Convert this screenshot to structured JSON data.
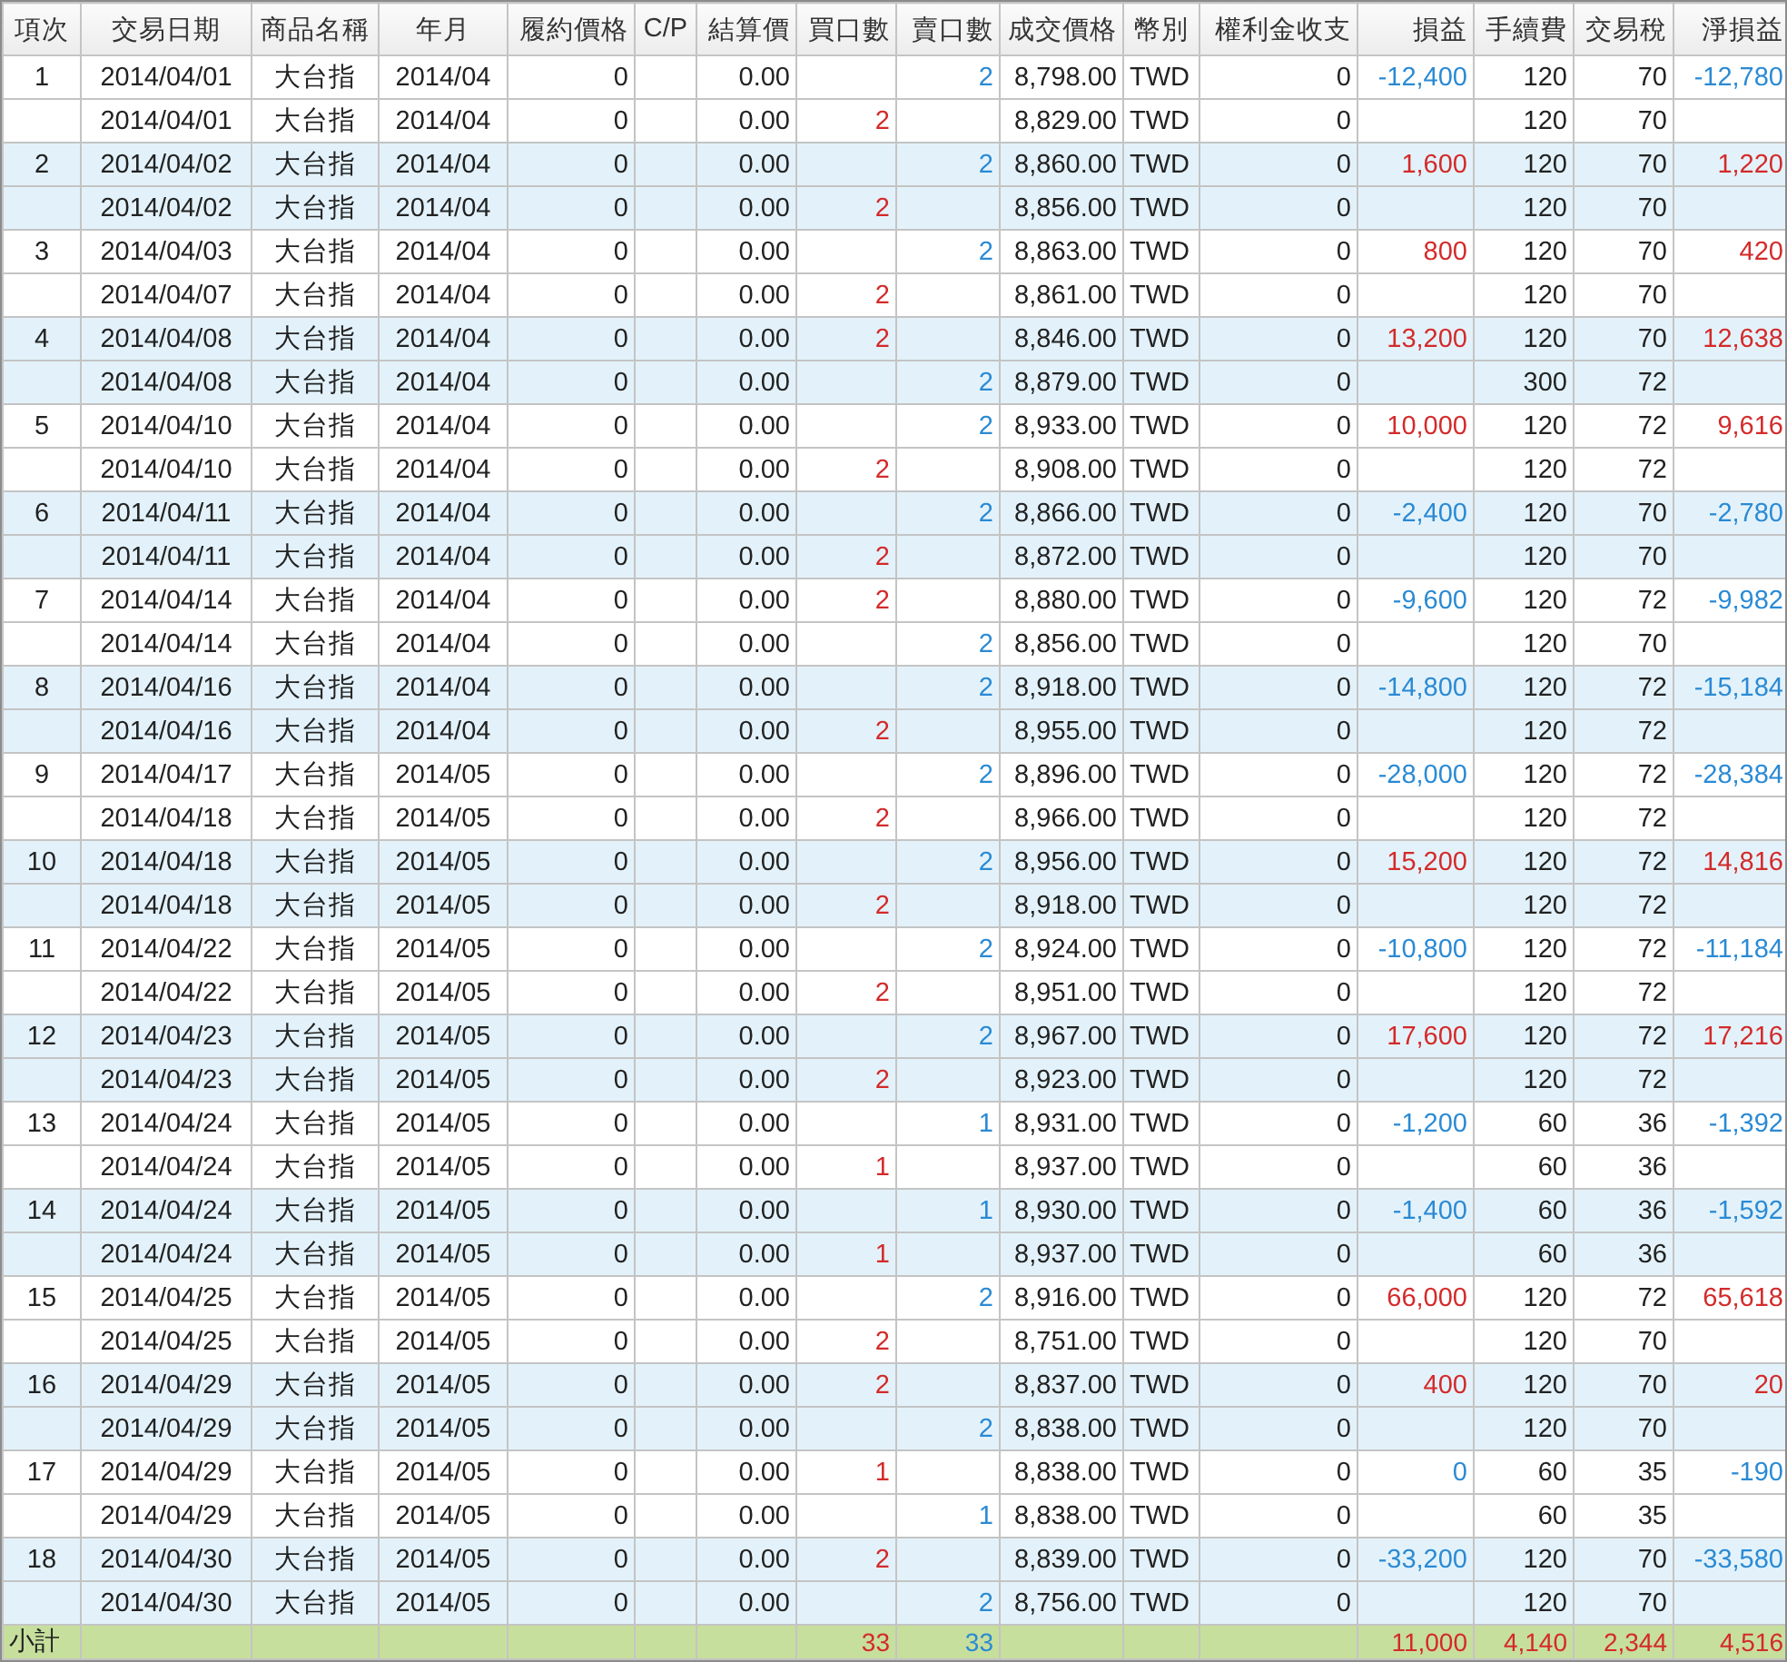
{
  "columns": [
    "項次",
    "交易日期",
    "商品名稱",
    "年月",
    "履約價格",
    "C/P",
    "結算價",
    "買口數",
    "賣口數",
    "成交價格",
    "幣別",
    "權利金收支",
    "損益",
    "手續費",
    "交易稅",
    "淨損益"
  ],
  "items": [
    {
      "no": "1",
      "pnl": {
        "value": "-12,400",
        "color": "#2a8ad4"
      },
      "net": {
        "value": "-12,780",
        "color": "#2a8ad4"
      },
      "trades": [
        {
          "date": "2014/04/01",
          "product": "大台指",
          "month": "2014/04",
          "strike": "0",
          "settle": "0.00",
          "sell": "2",
          "price": "8,798.00",
          "currency": "TWD",
          "premium": "0",
          "fee": "120",
          "tax": "70"
        },
        {
          "date": "2014/04/01",
          "product": "大台指",
          "month": "2014/04",
          "strike": "0",
          "settle": "0.00",
          "buy": "2",
          "price": "8,829.00",
          "currency": "TWD",
          "premium": "0",
          "fee": "120",
          "tax": "70"
        }
      ]
    },
    {
      "no": "2",
      "pnl": {
        "value": "1,600",
        "color": "#d42a2a"
      },
      "net": {
        "value": "1,220",
        "color": "#d42a2a"
      },
      "trades": [
        {
          "date": "2014/04/02",
          "product": "大台指",
          "month": "2014/04",
          "strike": "0",
          "settle": "0.00",
          "sell": "2",
          "price": "8,860.00",
          "currency": "TWD",
          "premium": "0",
          "fee": "120",
          "tax": "70"
        },
        {
          "date": "2014/04/02",
          "product": "大台指",
          "month": "2014/04",
          "strike": "0",
          "settle": "0.00",
          "buy": "2",
          "price": "8,856.00",
          "currency": "TWD",
          "premium": "0",
          "fee": "120",
          "tax": "70"
        }
      ]
    },
    {
      "no": "3",
      "pnl": {
        "value": "800",
        "color": "#d42a2a"
      },
      "net": {
        "value": "420",
        "color": "#d42a2a"
      },
      "trades": [
        {
          "date": "2014/04/03",
          "product": "大台指",
          "month": "2014/04",
          "strike": "0",
          "settle": "0.00",
          "sell": "2",
          "price": "8,863.00",
          "currency": "TWD",
          "premium": "0",
          "fee": "120",
          "tax": "70"
        },
        {
          "date": "2014/04/07",
          "product": "大台指",
          "month": "2014/04",
          "strike": "0",
          "settle": "0.00",
          "buy": "2",
          "price": "8,861.00",
          "currency": "TWD",
          "premium": "0",
          "fee": "120",
          "tax": "70"
        }
      ]
    },
    {
      "no": "4",
      "pnl": {
        "value": "13,200",
        "color": "#d42a2a"
      },
      "net": {
        "value": "12,638",
        "color": "#d42a2a"
      },
      "trades": [
        {
          "date": "2014/04/08",
          "product": "大台指",
          "month": "2014/04",
          "strike": "0",
          "settle": "0.00",
          "buy": "2",
          "price": "8,846.00",
          "currency": "TWD",
          "premium": "0",
          "fee": "120",
          "tax": "70"
        },
        {
          "date": "2014/04/08",
          "product": "大台指",
          "month": "2014/04",
          "strike": "0",
          "settle": "0.00",
          "sell": "2",
          "price": "8,879.00",
          "currency": "TWD",
          "premium": "0",
          "fee": "300",
          "tax": "72"
        }
      ]
    },
    {
      "no": "5",
      "pnl": {
        "value": "10,000",
        "color": "#d42a2a"
      },
      "net": {
        "value": "9,616",
        "color": "#d42a2a"
      },
      "trades": [
        {
          "date": "2014/04/10",
          "product": "大台指",
          "month": "2014/04",
          "strike": "0",
          "settle": "0.00",
          "sell": "2",
          "price": "8,933.00",
          "currency": "TWD",
          "premium": "0",
          "fee": "120",
          "tax": "72"
        },
        {
          "date": "2014/04/10",
          "product": "大台指",
          "month": "2014/04",
          "strike": "0",
          "settle": "0.00",
          "buy": "2",
          "price": "8,908.00",
          "currency": "TWD",
          "premium": "0",
          "fee": "120",
          "tax": "72"
        }
      ]
    },
    {
      "no": "6",
      "pnl": {
        "value": "-2,400",
        "color": "#2a8ad4"
      },
      "net": {
        "value": "-2,780",
        "color": "#2a8ad4"
      },
      "trades": [
        {
          "date": "2014/04/11",
          "product": "大台指",
          "month": "2014/04",
          "strike": "0",
          "settle": "0.00",
          "sell": "2",
          "price": "8,866.00",
          "currency": "TWD",
          "premium": "0",
          "fee": "120",
          "tax": "70"
        },
        {
          "date": "2014/04/11",
          "product": "大台指",
          "month": "2014/04",
          "strike": "0",
          "settle": "0.00",
          "buy": "2",
          "price": "8,872.00",
          "currency": "TWD",
          "premium": "0",
          "fee": "120",
          "tax": "70"
        }
      ]
    },
    {
      "no": "7",
      "pnl": {
        "value": "-9,600",
        "color": "#2a8ad4"
      },
      "net": {
        "value": "-9,982",
        "color": "#2a8ad4"
      },
      "trades": [
        {
          "date": "2014/04/14",
          "product": "大台指",
          "month": "2014/04",
          "strike": "0",
          "settle": "0.00",
          "buy": "2",
          "price": "8,880.00",
          "currency": "TWD",
          "premium": "0",
          "fee": "120",
          "tax": "72"
        },
        {
          "date": "2014/04/14",
          "product": "大台指",
          "month": "2014/04",
          "strike": "0",
          "settle": "0.00",
          "sell": "2",
          "price": "8,856.00",
          "currency": "TWD",
          "premium": "0",
          "fee": "120",
          "tax": "70"
        }
      ]
    },
    {
      "no": "8",
      "pnl": {
        "value": "-14,800",
        "color": "#2a8ad4"
      },
      "net": {
        "value": "-15,184",
        "color": "#2a8ad4"
      },
      "trades": [
        {
          "date": "2014/04/16",
          "product": "大台指",
          "month": "2014/04",
          "strike": "0",
          "settle": "0.00",
          "sell": "2",
          "price": "8,918.00",
          "currency": "TWD",
          "premium": "0",
          "fee": "120",
          "tax": "72"
        },
        {
          "date": "2014/04/16",
          "product": "大台指",
          "month": "2014/04",
          "strike": "0",
          "settle": "0.00",
          "buy": "2",
          "price": "8,955.00",
          "currency": "TWD",
          "premium": "0",
          "fee": "120",
          "tax": "72"
        }
      ]
    },
    {
      "no": "9",
      "pnl": {
        "value": "-28,000",
        "color": "#2a8ad4"
      },
      "net": {
        "value": "-28,384",
        "color": "#2a8ad4"
      },
      "trades": [
        {
          "date": "2014/04/17",
          "product": "大台指",
          "month": "2014/05",
          "strike": "0",
          "settle": "0.00",
          "sell": "2",
          "price": "8,896.00",
          "currency": "TWD",
          "premium": "0",
          "fee": "120",
          "tax": "72"
        },
        {
          "date": "2014/04/18",
          "product": "大台指",
          "month": "2014/05",
          "strike": "0",
          "settle": "0.00",
          "buy": "2",
          "price": "8,966.00",
          "currency": "TWD",
          "premium": "0",
          "fee": "120",
          "tax": "72"
        }
      ]
    },
    {
      "no": "10",
      "pnl": {
        "value": "15,200",
        "color": "#d42a2a"
      },
      "net": {
        "value": "14,816",
        "color": "#d42a2a"
      },
      "trades": [
        {
          "date": "2014/04/18",
          "product": "大台指",
          "month": "2014/05",
          "strike": "0",
          "settle": "0.00",
          "sell": "2",
          "price": "8,956.00",
          "currency": "TWD",
          "premium": "0",
          "fee": "120",
          "tax": "72"
        },
        {
          "date": "2014/04/18",
          "product": "大台指",
          "month": "2014/05",
          "strike": "0",
          "settle": "0.00",
          "buy": "2",
          "price": "8,918.00",
          "currency": "TWD",
          "premium": "0",
          "fee": "120",
          "tax": "72"
        }
      ]
    },
    {
      "no": "11",
      "pnl": {
        "value": "-10,800",
        "color": "#2a8ad4"
      },
      "net": {
        "value": "-11,184",
        "color": "#2a8ad4"
      },
      "trades": [
        {
          "date": "2014/04/22",
          "product": "大台指",
          "month": "2014/05",
          "strike": "0",
          "settle": "0.00",
          "sell": "2",
          "price": "8,924.00",
          "currency": "TWD",
          "premium": "0",
          "fee": "120",
          "tax": "72"
        },
        {
          "date": "2014/04/22",
          "product": "大台指",
          "month": "2014/05",
          "strike": "0",
          "settle": "0.00",
          "buy": "2",
          "price": "8,951.00",
          "currency": "TWD",
          "premium": "0",
          "fee": "120",
          "tax": "72"
        }
      ]
    },
    {
      "no": "12",
      "pnl": {
        "value": "17,600",
        "color": "#d42a2a"
      },
      "net": {
        "value": "17,216",
        "color": "#d42a2a"
      },
      "trades": [
        {
          "date": "2014/04/23",
          "product": "大台指",
          "month": "2014/05",
          "strike": "0",
          "settle": "0.00",
          "sell": "2",
          "price": "8,967.00",
          "currency": "TWD",
          "premium": "0",
          "fee": "120",
          "tax": "72"
        },
        {
          "date": "2014/04/23",
          "product": "大台指",
          "month": "2014/05",
          "strike": "0",
          "settle": "0.00",
          "buy": "2",
          "price": "8,923.00",
          "currency": "TWD",
          "premium": "0",
          "fee": "120",
          "tax": "72"
        }
      ]
    },
    {
      "no": "13",
      "pnl": {
        "value": "-1,200",
        "color": "#2a8ad4"
      },
      "net": {
        "value": "-1,392",
        "color": "#2a8ad4"
      },
      "trades": [
        {
          "date": "2014/04/24",
          "product": "大台指",
          "month": "2014/05",
          "strike": "0",
          "settle": "0.00",
          "sell": "1",
          "price": "8,931.00",
          "currency": "TWD",
          "premium": "0",
          "fee": "60",
          "tax": "36"
        },
        {
          "date": "2014/04/24",
          "product": "大台指",
          "month": "2014/05",
          "strike": "0",
          "settle": "0.00",
          "buy": "1",
          "price": "8,937.00",
          "currency": "TWD",
          "premium": "0",
          "fee": "60",
          "tax": "36"
        }
      ]
    },
    {
      "no": "14",
      "pnl": {
        "value": "-1,400",
        "color": "#2a8ad4"
      },
      "net": {
        "value": "-1,592",
        "color": "#2a8ad4"
      },
      "trades": [
        {
          "date": "2014/04/24",
          "product": "大台指",
          "month": "2014/05",
          "strike": "0",
          "settle": "0.00",
          "sell": "1",
          "price": "8,930.00",
          "currency": "TWD",
          "premium": "0",
          "fee": "60",
          "tax": "36"
        },
        {
          "date": "2014/04/24",
          "product": "大台指",
          "month": "2014/05",
          "strike": "0",
          "settle": "0.00",
          "buy": "1",
          "price": "8,937.00",
          "currency": "TWD",
          "premium": "0",
          "fee": "60",
          "tax": "36"
        }
      ]
    },
    {
      "no": "15",
      "pnl": {
        "value": "66,000",
        "color": "#d42a2a"
      },
      "net": {
        "value": "65,618",
        "color": "#d42a2a"
      },
      "trades": [
        {
          "date": "2014/04/25",
          "product": "大台指",
          "month": "2014/05",
          "strike": "0",
          "settle": "0.00",
          "sell": "2",
          "price": "8,916.00",
          "currency": "TWD",
          "premium": "0",
          "fee": "120",
          "tax": "72"
        },
        {
          "date": "2014/04/25",
          "product": "大台指",
          "month": "2014/05",
          "strike": "0",
          "settle": "0.00",
          "buy": "2",
          "price": "8,751.00",
          "currency": "TWD",
          "premium": "0",
          "fee": "120",
          "tax": "70"
        }
      ]
    },
    {
      "no": "16",
      "pnl": {
        "value": "400",
        "color": "#d42a2a"
      },
      "net": {
        "value": "20",
        "color": "#d42a2a"
      },
      "trades": [
        {
          "date": "2014/04/29",
          "product": "大台指",
          "month": "2014/05",
          "strike": "0",
          "settle": "0.00",
          "buy": "2",
          "price": "8,837.00",
          "currency": "TWD",
          "premium": "0",
          "fee": "120",
          "tax": "70"
        },
        {
          "date": "2014/04/29",
          "product": "大台指",
          "month": "2014/05",
          "strike": "0",
          "settle": "0.00",
          "sell": "2",
          "price": "8,838.00",
          "currency": "TWD",
          "premium": "0",
          "fee": "120",
          "tax": "70"
        }
      ]
    },
    {
      "no": "17",
      "pnl": {
        "value": "0",
        "color": "#2a8ad4"
      },
      "net": {
        "value": "-190",
        "color": "#2a8ad4"
      },
      "trades": [
        {
          "date": "2014/04/29",
          "product": "大台指",
          "month": "2014/05",
          "strike": "0",
          "settle": "0.00",
          "buy": "1",
          "price": "8,838.00",
          "currency": "TWD",
          "premium": "0",
          "fee": "60",
          "tax": "35"
        },
        {
          "date": "2014/04/29",
          "product": "大台指",
          "month": "2014/05",
          "strike": "0",
          "settle": "0.00",
          "sell": "1",
          "price": "8,838.00",
          "currency": "TWD",
          "premium": "0",
          "fee": "60",
          "tax": "35"
        }
      ]
    },
    {
      "no": "18",
      "pnl": {
        "value": "-33,200",
        "color": "#2a8ad4"
      },
      "net": {
        "value": "-33,580",
        "color": "#2a8ad4"
      },
      "trades": [
        {
          "date": "2014/04/30",
          "product": "大台指",
          "month": "2014/05",
          "strike": "0",
          "settle": "0.00",
          "buy": "2",
          "price": "8,839.00",
          "currency": "TWD",
          "premium": "0",
          "fee": "120",
          "tax": "70"
        },
        {
          "date": "2014/04/30",
          "product": "大台指",
          "month": "2014/05",
          "strike": "0",
          "settle": "0.00",
          "sell": "2",
          "price": "8,756.00",
          "currency": "TWD",
          "premium": "0",
          "fee": "120",
          "tax": "70"
        }
      ]
    }
  ],
  "subtotal": {
    "label": "小計",
    "buy": "33",
    "sell": "33",
    "pnl": {
      "value": "11,000",
      "color": "#d42a2a"
    },
    "fee": {
      "value": "4,140",
      "color": "#d42a2a"
    },
    "tax": {
      "value": "2,344",
      "color": "#d42a2a"
    },
    "net": {
      "value": "4,516",
      "color": "#d42a2a"
    }
  }
}
